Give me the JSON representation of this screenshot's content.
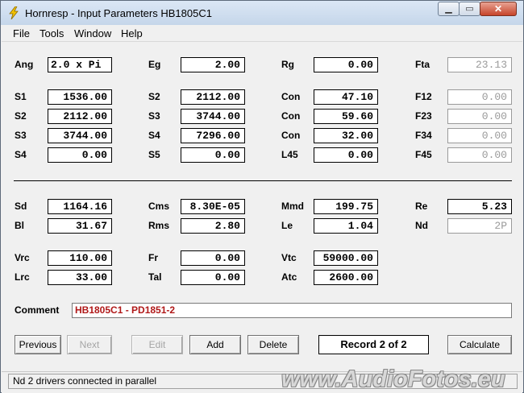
{
  "window": {
    "title": "Hornresp - Input Parameters    HB1805C1",
    "controls": {
      "minimize": "▁",
      "maximize": "▭",
      "close": "✕"
    }
  },
  "menu": [
    "File",
    "Tools",
    "Window",
    "Help"
  ],
  "params": {
    "ang": {
      "label": "Ang",
      "value": "2.0 x Pi"
    },
    "eg": {
      "label": "Eg",
      "value": "2.00"
    },
    "rg": {
      "label": "Rg",
      "value": "0.00"
    },
    "fta": {
      "label": "Fta",
      "value": "23.13"
    },
    "s1": {
      "label": "S1",
      "value": "1536.00"
    },
    "s2a": {
      "label": "S2",
      "value": "2112.00"
    },
    "con1": {
      "label": "Con",
      "value": "47.10"
    },
    "f12": {
      "label": "F12",
      "value": "0.00"
    },
    "s2b": {
      "label": "S2",
      "value": "2112.00"
    },
    "s3a": {
      "label": "S3",
      "value": "3744.00"
    },
    "con2": {
      "label": "Con",
      "value": "59.60"
    },
    "f23": {
      "label": "F23",
      "value": "0.00"
    },
    "s3b": {
      "label": "S3",
      "value": "3744.00"
    },
    "s4a": {
      "label": "S4",
      "value": "7296.00"
    },
    "con3": {
      "label": "Con",
      "value": "32.00"
    },
    "f34": {
      "label": "F34",
      "value": "0.00"
    },
    "s4b": {
      "label": "S4",
      "value": "0.00"
    },
    "s5": {
      "label": "S5",
      "value": "0.00"
    },
    "l45": {
      "label": "L45",
      "value": "0.00"
    },
    "f45": {
      "label": "F45",
      "value": "0.00"
    },
    "sd": {
      "label": "Sd",
      "value": "1164.16"
    },
    "cms": {
      "label": "Cms",
      "value": "8.30E-05"
    },
    "mmd": {
      "label": "Mmd",
      "value": "199.75"
    },
    "re": {
      "label": "Re",
      "value": "5.23"
    },
    "bl": {
      "label": "Bl",
      "value": "31.67"
    },
    "rms": {
      "label": "Rms",
      "value": "2.80"
    },
    "le": {
      "label": "Le",
      "value": "1.04"
    },
    "nd": {
      "label": "Nd",
      "value": "2P"
    },
    "vrc": {
      "label": "Vrc",
      "value": "110.00"
    },
    "fr": {
      "label": "Fr",
      "value": "0.00"
    },
    "vtc": {
      "label": "Vtc",
      "value": "59000.00"
    },
    "lrc": {
      "label": "Lrc",
      "value": "33.00"
    },
    "tal": {
      "label": "Tal",
      "value": "0.00"
    },
    "atc": {
      "label": "Atc",
      "value": "2600.00"
    }
  },
  "comment": {
    "label": "Comment",
    "value": "HB1805C1 - PD1851-2"
  },
  "buttons": {
    "previous": "Previous",
    "next": "Next",
    "edit": "Edit",
    "add": "Add",
    "delete": "Delete",
    "calculate": "Calculate"
  },
  "record": "Record 2 of 2",
  "status": "Nd   2 drivers connected in parallel",
  "watermark": "www.AudioFotos.eu"
}
